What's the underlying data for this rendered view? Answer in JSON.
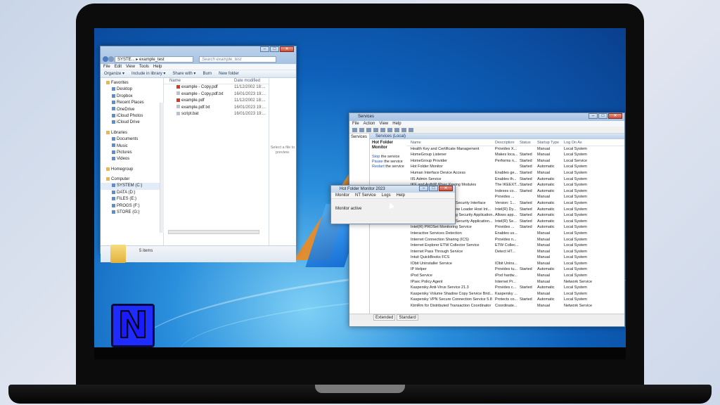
{
  "explorer": {
    "address": "SYSTE... ▸ example_test",
    "search_placeholder": "Search example_test",
    "menu": [
      "File",
      "Edit",
      "View",
      "Tools",
      "Help"
    ],
    "toolbar": [
      "Organize ▾",
      "Include in library ▾",
      "Share with ▾",
      "Burn",
      "New folder"
    ],
    "nav": [
      {
        "label": "Favorites",
        "group": true
      },
      {
        "label": "Desktop"
      },
      {
        "label": "Dropbox"
      },
      {
        "label": "Recent Places"
      },
      {
        "label": "OneDrive"
      },
      {
        "label": "iCloud Photos"
      },
      {
        "label": "iCloud Drive"
      },
      {
        "label": "",
        "gap": true
      },
      {
        "label": "Libraries",
        "group": true
      },
      {
        "label": "Documents"
      },
      {
        "label": "Music"
      },
      {
        "label": "Pictures"
      },
      {
        "label": "Videos"
      },
      {
        "label": "",
        "gap": true
      },
      {
        "label": "Homegroup",
        "group": true
      },
      {
        "label": "",
        "gap": true
      },
      {
        "label": "Computer",
        "group": true
      },
      {
        "label": "SYSTEM (C:)",
        "selected": true
      },
      {
        "label": "DATA (D:)"
      },
      {
        "label": "FILES (E:)"
      },
      {
        "label": "PROGS (F:)"
      },
      {
        "label": "STORE (G:)"
      }
    ],
    "columns": {
      "name": "Name",
      "date": "Date modified"
    },
    "files": [
      {
        "name": "example - Copy.pdf",
        "date": "11/12/2002 18:..."
      },
      {
        "name": "example - Copy.pdf.txt",
        "date": "16/01/2023 19:..."
      },
      {
        "name": "example.pdf",
        "date": "11/12/2002 18:..."
      },
      {
        "name": "example.pdf.txt",
        "date": "16/01/2023 19:..."
      },
      {
        "name": "script.bat",
        "date": "16/01/2023 19:..."
      }
    ],
    "preview": "Select a file to preview.",
    "item_count": "5 items"
  },
  "services": {
    "title": "Services",
    "menu": [
      "File",
      "Action",
      "View",
      "Help"
    ],
    "tree": "Services",
    "header": "Services (Local)",
    "selected_name": "Hot Folder Monitor",
    "actions": [
      {
        "link": "Stop",
        "rest": " the service"
      },
      {
        "link": "Pause",
        "rest": " the service"
      },
      {
        "link": "Restart",
        "rest": " the service"
      }
    ],
    "columns": [
      "Name",
      "Description",
      "Status",
      "Startup Type",
      "Log On As"
    ],
    "rows": [
      [
        "Health Key and Certificate Management",
        "Provides X...",
        "",
        "Manual",
        "Local System"
      ],
      [
        "HomeGroup Listener",
        "Makes loca...",
        "Started",
        "Manual",
        "Local System"
      ],
      [
        "HomeGroup Provider",
        "Performs n...",
        "Started",
        "Manual",
        "Local Service"
      ],
      [
        "Hot Folder Monitor",
        "",
        "Started",
        "Automatic",
        "Local System"
      ],
      [
        "Human Interface Device Access",
        "Enables ge...",
        "Started",
        "Manual",
        "Local System"
      ],
      [
        "IIS Admin Service",
        "Enables th...",
        "Started",
        "Automatic",
        "Local System"
      ],
      [
        "IKE and AuthIP IPsec Keying Modules",
        "The IKEEXT...",
        "Started",
        "Automatic",
        "Local System"
      ],
      [
        "",
        "Indexes co...",
        "Started",
        "Automatic",
        "Local System"
      ],
      [
        "",
        "Provides ...",
        "",
        "Manual",
        "Local System"
      ],
      [
        "Intel(R) Management and Security Interface",
        "Version: 1...",
        "Started",
        "Automatic",
        "Local System"
      ],
      [
        "Intel(R) Management Engine Loader Host Int...",
        "Intel(R) Dy...",
        "Started",
        "Automatic",
        "Local System"
      ],
      [
        "Intel(R) PROSet Monitoring Security Application...",
        "Allows app...",
        "Started",
        "Automatic",
        "Local System"
      ],
      [
        "Intel(R) PROSet/Wireless Security Application...",
        "Intel(R) Se...",
        "Started",
        "Automatic",
        "Local System"
      ],
      [
        "Intel(R) PROSet Monitoring Service",
        "Provides ...",
        "Started",
        "Automatic",
        "Local System"
      ],
      [
        "Interactive Services Detection",
        "Enables us...",
        "",
        "Manual",
        "Local System"
      ],
      [
        "Internet Connection Sharing (ICS)",
        "Provides n...",
        "",
        "Manual",
        "Local System"
      ],
      [
        "Internet Explorer ETW Collector Service",
        "ETW Collec...",
        "",
        "Manual",
        "Local System"
      ],
      [
        "Internet Pass Through Service",
        "Detect HT...",
        "",
        "Manual",
        "Local System"
      ],
      [
        "Intuit QuickBooks FCS",
        "",
        "",
        "Manual",
        "Local System"
      ],
      [
        "IObit Uninstaller Service",
        "IObit Unins...",
        "",
        "Manual",
        "Local System"
      ],
      [
        "IP Helper",
        "Provides tu...",
        "Started",
        "Automatic",
        "Local System"
      ],
      [
        "iPod Service",
        "iPod hardw...",
        "",
        "Manual",
        "Local System"
      ],
      [
        "IPsec Policy Agent",
        "Internet Pr...",
        "",
        "Manual",
        "Network Service"
      ],
      [
        "Kaspersky Anti-Virus Service 21.3",
        "Provides c...",
        "Started",
        "Automatic",
        "Local System"
      ],
      [
        "Kaspersky Volume Shadow Copy Service Brid...",
        "Kaspersky ...",
        "",
        "Manual",
        "Local System"
      ],
      [
        "Kaspersky VPN Secure Connection Service 5.8",
        "Protects co...",
        "Started",
        "Automatic",
        "Local System"
      ],
      [
        "KtmRm for Distributed Transaction Coordinator",
        "Coordinate...",
        "",
        "Manual",
        "Network Service"
      ]
    ],
    "tabs": [
      "Extended",
      "Standard"
    ]
  },
  "hfm": {
    "title": "Hot Folder Monitor 2023",
    "menu": [
      "Monitor",
      "NT Service",
      "Logs",
      "Help"
    ],
    "status": "Monitor active"
  },
  "colors": {
    "accent": "#1a57b0",
    "desktop": "#0d5fb8",
    "logo": "#1f2cff"
  }
}
